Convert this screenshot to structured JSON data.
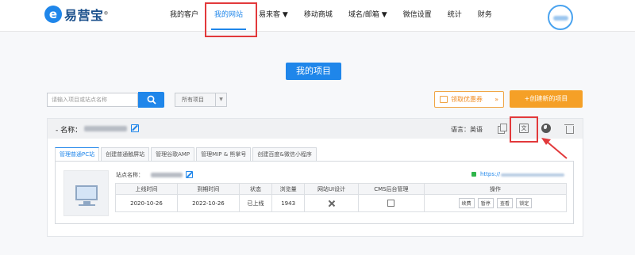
{
  "brand": {
    "name": "易营宝",
    "sup": "®",
    "mark": "e"
  },
  "nav": [
    {
      "label": "我的客户"
    },
    {
      "label": "我的网站",
      "active": true
    },
    {
      "label": "易来客 ▼"
    },
    {
      "label": "移动商城"
    },
    {
      "label": "域名/邮箱 ▼"
    },
    {
      "label": "微信设置"
    },
    {
      "label": "统计"
    },
    {
      "label": "财务"
    }
  ],
  "page_title": "我的项目",
  "search": {
    "placeholder": "请输入项目或站点名称"
  },
  "filter": {
    "value": "所有项目"
  },
  "promo": {
    "label": "领取优惠券",
    "arrow": "»"
  },
  "create": {
    "label": "+创建新的项目"
  },
  "project": {
    "name_label": "- 名称：",
    "lang_label": "语言：英语",
    "tabs": [
      {
        "label": "管理普通PC站",
        "active": true
      },
      {
        "label": "创建普通触屏站"
      },
      {
        "label": "管理谷歌AMP"
      },
      {
        "label": "管理MIP & 熊掌号"
      },
      {
        "label": "创建百度&微信小程序"
      }
    ],
    "site_label": "站点名称：",
    "url_prefix": "https://",
    "table": {
      "headers": [
        "上线时间",
        "到期时间",
        "状态",
        "浏览量",
        "网站UI设计",
        "CMS后台管理",
        "操作"
      ],
      "row": {
        "online_date": "2020-10-26",
        "expire_date": "2022-10-26",
        "status": "已上线",
        "views": "1943"
      },
      "actions": [
        "续费",
        "暂停",
        "查看",
        "锁定"
      ]
    }
  },
  "colors": {
    "primary": "#1f86ea",
    "accent": "#f5a027",
    "highlight": "#e2393b",
    "online": "#2fb54b"
  }
}
